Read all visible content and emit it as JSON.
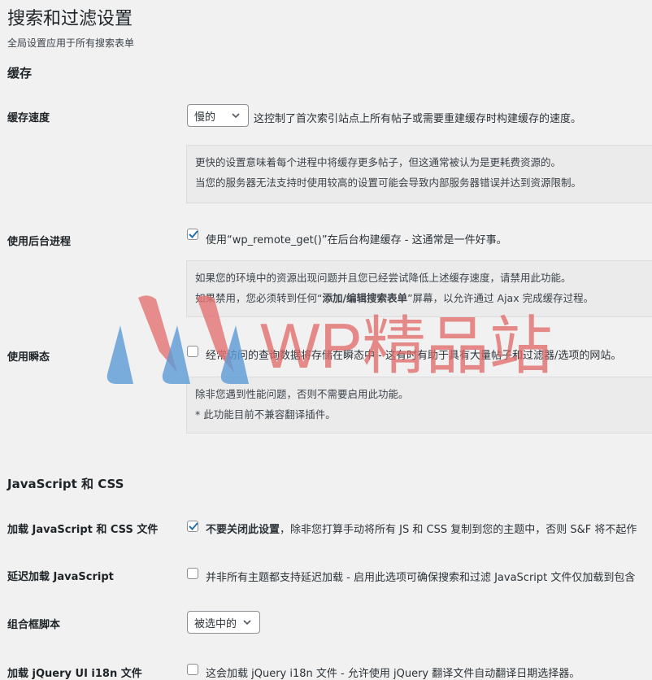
{
  "page": {
    "title": "搜索和过滤设置",
    "subtitle": "全局设置应用于所有搜索表单"
  },
  "cache": {
    "section_title": "缓存",
    "speed_label": "缓存速度",
    "speed_select": "慢的",
    "speed_desc": "这控制了首次索引站点上所有帖子或需要重建缓存时构建缓存的速度。",
    "speed_note": [
      "更快的设置意味着每个进程中将缓存更多帖子，但这通常被认为是更耗费资源的。",
      "当您的服务器无法支持时使用较高的设置可能会导致内部服务器错误并达到资源限制。"
    ],
    "bg_label": "使用后台进程",
    "bg_checked": true,
    "bg_desc": "使用“wp_remote_get()”在后台构建缓存 - 这通常是一件好事。",
    "bg_note_1": "如果您的环境中的资源出现问题并且您已经尝试降低上述缓存速度，请禁用此功能。",
    "bg_note_2a": "如果禁用，您必须转到任何“",
    "bg_note_2b": "添加/编辑搜索表单",
    "bg_note_2c": "”屏幕，以允许通过 Ajax 完成缓存过程。",
    "transient_label": "使用瞬态",
    "transient_checked": false,
    "transient_desc": "经常访问的查询数据将存储在瞬态中 - 这有时有助于具有大量帖子和过滤器/选项的网站。",
    "transient_note": [
      "除非您遇到性能问题，否则不需要启用此功能。",
      "* 此功能目前不兼容翻译插件。"
    ]
  },
  "js_css": {
    "section_title": "JavaScript 和 CSS",
    "load_label": "加载 JavaScript 和 CSS 文件",
    "load_checked": true,
    "load_desc_strong": "不要关闭此设置",
    "load_desc_rest": "，除非您打算手动将所有 JS 和 CSS 复制到您的主题中，否则 S&F 将不起作",
    "lazy_label": "延迟加载 JavaScript",
    "lazy_checked": false,
    "lazy_desc": "并非所有主题都支持延迟加载 - 启用此选项可确保搜索和过滤 JavaScript 文件仅加载到包含",
    "combo_label": "组合框脚本",
    "combo_select": "被选中的",
    "i18n_label": "加载 jQuery UI i18n 文件",
    "i18n_checked": false,
    "i18n_desc": "这会加载 jQuery i18n 文件 - 允许使用 jQuery 翻译文件自动翻译日期选择器。"
  },
  "watermark": {
    "text": "WP精品站"
  },
  "colors": {
    "accent": "#2271b1",
    "text": "#1d2327",
    "background": "#f1f1f1"
  }
}
